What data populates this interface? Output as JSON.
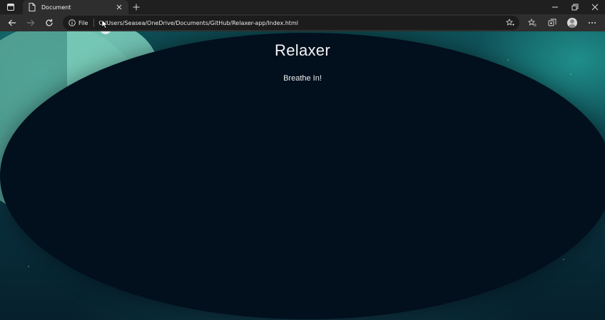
{
  "browser": {
    "tab": {
      "title": "Document"
    },
    "address_bar": {
      "site_info_label": "File",
      "url": "C:/Users/Seasea/OneDrive/Documents/GitHub/Relaxer-app/Index.html"
    },
    "icons": {
      "tab_actions": "tab-actions-icon",
      "tab_favicon": "document-icon",
      "tab_close": "close-icon",
      "new_tab": "plus-icon",
      "back": "back-arrow-icon",
      "forward": "forward-arrow-icon",
      "refresh": "refresh-icon",
      "site_info": "info-icon",
      "add_favorite": "add-favorite-icon",
      "favorites": "favorites-icon",
      "collections": "collections-icon",
      "profile": "avatar",
      "menu": "more-icon"
    }
  },
  "page": {
    "title": "Relaxer",
    "instruction": "Breathe In!"
  },
  "colors": {
    "oval": "#020f1d",
    "background_teal": "#0e4a52",
    "circle_green": "#5aa89a",
    "circle_light": "#79cbb9"
  }
}
